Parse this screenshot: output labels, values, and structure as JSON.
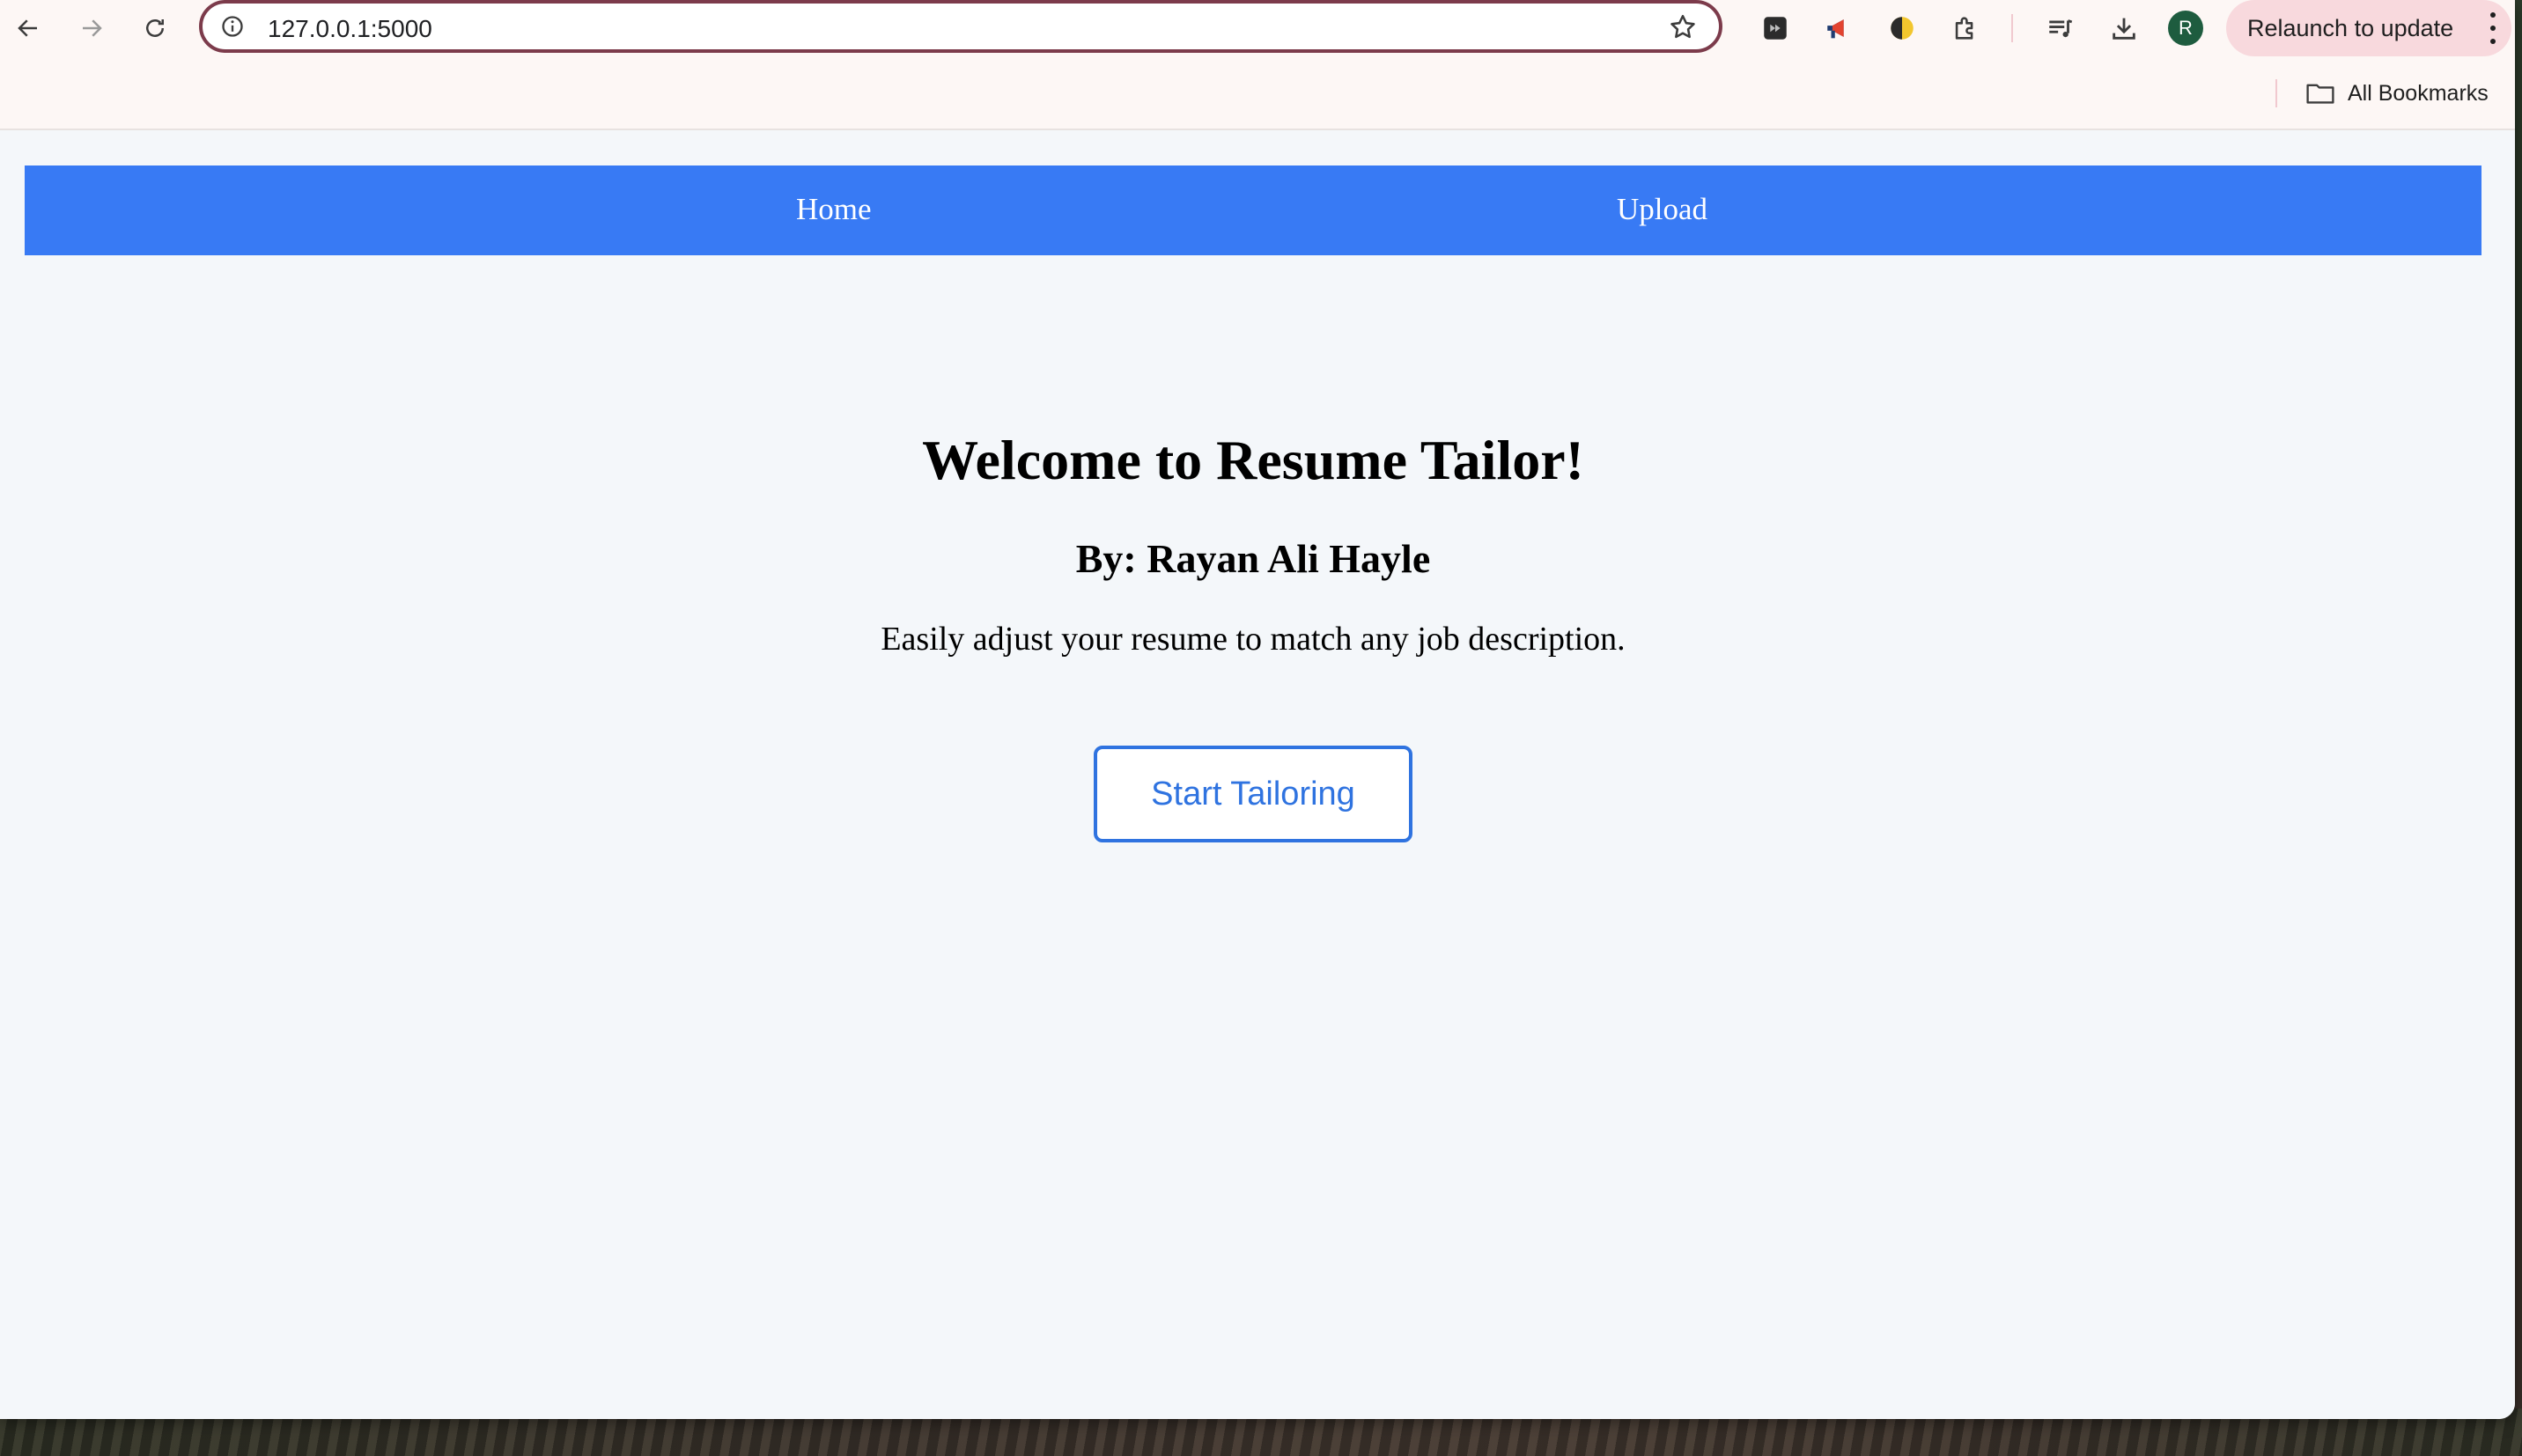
{
  "browser": {
    "url": "127.0.0.1:5000",
    "profile_initial": "R",
    "relaunch_label": "Relaunch to update",
    "bookmarks_label": "All Bookmarks",
    "icons": {
      "back": "back-arrow-icon",
      "forward": "forward-arrow-icon",
      "reload": "reload-icon",
      "site_info": "info-icon",
      "bookmark_star": "star-icon",
      "extensions": [
        "media-extension-icon",
        "megaphone-extension-icon",
        "half-moon-extension-icon",
        "puzzle-extensions-icon"
      ],
      "reading_list": "reading-list-icon",
      "downloads": "download-icon",
      "menu": "kebab-menu-icon",
      "bookmarks_folder": "folder-icon"
    },
    "colors": {
      "chrome_bg": "#fdf7f5",
      "omnibox_border": "#7c3b4b",
      "relaunch_bg": "#f8d9dd",
      "avatar_bg": "#1e5c3f"
    }
  },
  "site": {
    "nav": {
      "items": [
        {
          "label": "Home"
        },
        {
          "label": "Upload"
        }
      ],
      "bg_color": "#387af4"
    },
    "hero": {
      "title": "Welcome to Resume Tailor!",
      "author": "By: Rayan Ali Hayle",
      "tagline": "Easily adjust your resume to match any job description.",
      "cta_label": "Start Tailoring",
      "cta_color": "#2f73e0"
    },
    "page_bg": "#f4f7fa"
  }
}
